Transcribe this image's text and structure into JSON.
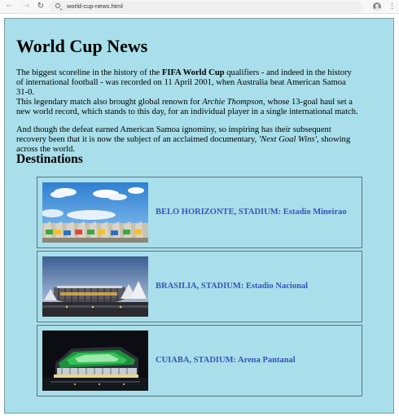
{
  "browser": {
    "url": "world-cup-news.html",
    "back_icon": "arrow-left-icon",
    "forward_icon": "arrow-right-icon",
    "reload_icon": "reload-icon",
    "search_icon": "search-icon",
    "profile_icon": "profile-icon",
    "menu_icon": "more-vertical-icon"
  },
  "page": {
    "title": "World Cup News",
    "paragraphs": {
      "p1": {
        "before": "The biggest scoreline in the history of the ",
        "bold": "FIFA World Cup",
        "after": " qualifiers - and indeed in the history of international football - was recorded on 11 April 2001, when Australia beat American Samoa 31-0."
      },
      "p2": {
        "before": "This legendary match also brought global renown for ",
        "italic": "Archie Thompson",
        "after": ", whose 13-goal haul set a new world record, which stands to this day, for an individual player in a single international match."
      },
      "p3": {
        "before": "And though the defeat earned American Samoa ignominy, so inspiring has their subsequent recovery been that it is now the subject of an acclaimed documentary, ",
        "italic": "'Next Goal Wins'",
        "after": ", showing across the world."
      }
    },
    "destinations_heading": "Destinations",
    "destinations": [
      {
        "city": "BELO HORIZONTE",
        "caption": "BELO HORIZONTE, STADIUM: Estadio Mineirao"
      },
      {
        "city": "BRASILIA",
        "caption": "BRASILIA, STADIUM: Estadio Nacional"
      },
      {
        "city": "CUIABA",
        "caption": "CUIABA, STADIUM: Arena Pantanal"
      }
    ]
  },
  "colors": {
    "page_background": "#a8dfea",
    "link_blue": "#3456b8",
    "card_border": "#5a7480"
  }
}
